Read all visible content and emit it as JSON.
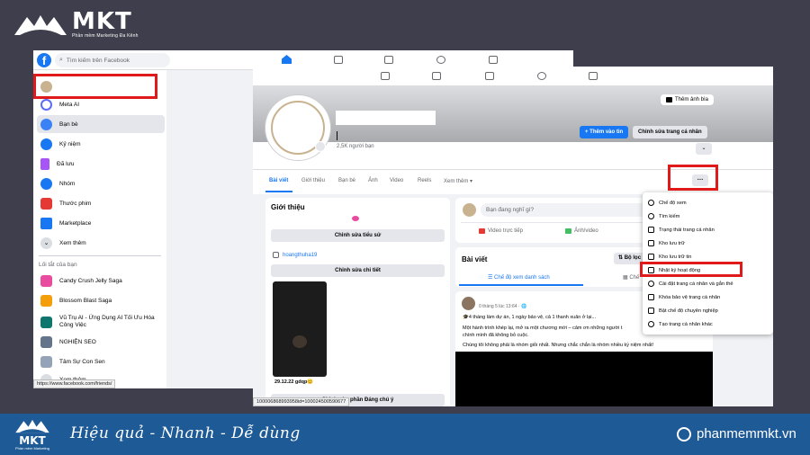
{
  "brand": {
    "name": "MKT",
    "sub": "Phần mềm Marketing Đa Kênh"
  },
  "footer": {
    "logo": "MKT",
    "logo_sub": "Phần mềm Marketing",
    "tagline": "Hiệu quả - Nhanh  - Dễ dùng",
    "site": "phanmemmkt.vn"
  },
  "shot1": {
    "search_placeholder": "Tìm kiếm trên Facebook",
    "sidebar": [
      {
        "label": "Meta AI",
        "color": "#5b6df5"
      },
      {
        "label": "Bạn bè",
        "color": "#3b82f6"
      },
      {
        "label": "Kỷ niệm",
        "color": "#1877f2"
      },
      {
        "label": "Đã lưu",
        "color": "#a855f7"
      },
      {
        "label": "Nhóm",
        "color": "#1877f2"
      },
      {
        "label": "Thước phim",
        "color": "#e53935"
      },
      {
        "label": "Marketplace",
        "color": "#1877f2"
      },
      {
        "label": "Xem thêm",
        "color": "#dadde1"
      }
    ],
    "shortcuts_title": "Lối tắt của bạn",
    "shortcuts": [
      {
        "label": "Candy Crush Jelly Saga",
        "color": "#e94b9e"
      },
      {
        "label": "Blossom Blast Saga",
        "color": "#f59e0b"
      },
      {
        "label": "Vũ Trụ AI - Ứng Dụng AI Tối Ưu Hóa Công Việc",
        "color": "#0f766e"
      },
      {
        "label": "NGHIỆN SEO",
        "color": "#64748b"
      },
      {
        "label": "Tâm Sự Con Sen",
        "color": "#94a3b8"
      },
      {
        "label": "Xem thêm",
        "color": "#dadde1"
      }
    ],
    "status_url": "https://www.facebook.com/friends/"
  },
  "shot2": {
    "cover_button": "Thêm ảnh bìa",
    "friends_count": "2,5K người bạn",
    "add_story": "+ Thêm vào tin",
    "edit_profile": "Chỉnh sửa trang cá nhân",
    "tabs": [
      "Bài viết",
      "Giới thiệu",
      "Bạn bè",
      "Ảnh",
      "Video",
      "Reels",
      "Xem thêm ▾"
    ],
    "intro": {
      "title": "Giới thiệu",
      "edit_bio": "Chỉnh sửa tiểu sử",
      "instagram": "hoangthuha19",
      "edit_details": "Chỉnh sửa chi tiết",
      "photo_caption": "29.12.22 gdqp😊",
      "edit_featured": "Chỉnh sửa phần Đáng chú ý"
    },
    "composer": {
      "placeholder": "Bạn đang nghĩ gì?",
      "live": "Video trực tiếp",
      "photo": "Ảnh/video"
    },
    "feed": {
      "title": "Bài viết",
      "filter": "Bộ lọc",
      "list_view": "☰ Chế độ xem danh sách",
      "grid_view": "Chế"
    },
    "post": {
      "time": "0 tháng 5 lúc 13:64 · 🌐",
      "line1": "🎓4 tháng làm dự án, 1 ngày bảo vệ, cả 1 thanh xuân ở lại...",
      "line2": "Một hành trình khép lại, mở ra một chương mới – cảm ơn những người t",
      "line3": "chính mình đã không bỏ cuộc.",
      "line4": "Chúng tôi không phải là nhóm giỏi nhất. Nhưng chắc chắn là nhóm nhiều kỷ niệm nhất!"
    },
    "menu": [
      "Chế độ xem",
      "Tìm kiếm",
      "Trạng thái trang cá nhân",
      "Kho lưu trữ",
      "Kho lưu trữ tin",
      "Nhật ký hoạt động",
      "Cài đặt trang cá nhân và gắn thẻ",
      "Khóa bảo vệ trang cá nhân",
      "Bật chế độ chuyên nghiệp",
      "Tạo trang cá nhân khác"
    ],
    "status_url": "100006868993958id=100024500590677"
  },
  "colors": {
    "facebook_blue": "#1877f2",
    "highlight_red": "#e0191b",
    "footer_blue": "#1d5a96"
  }
}
